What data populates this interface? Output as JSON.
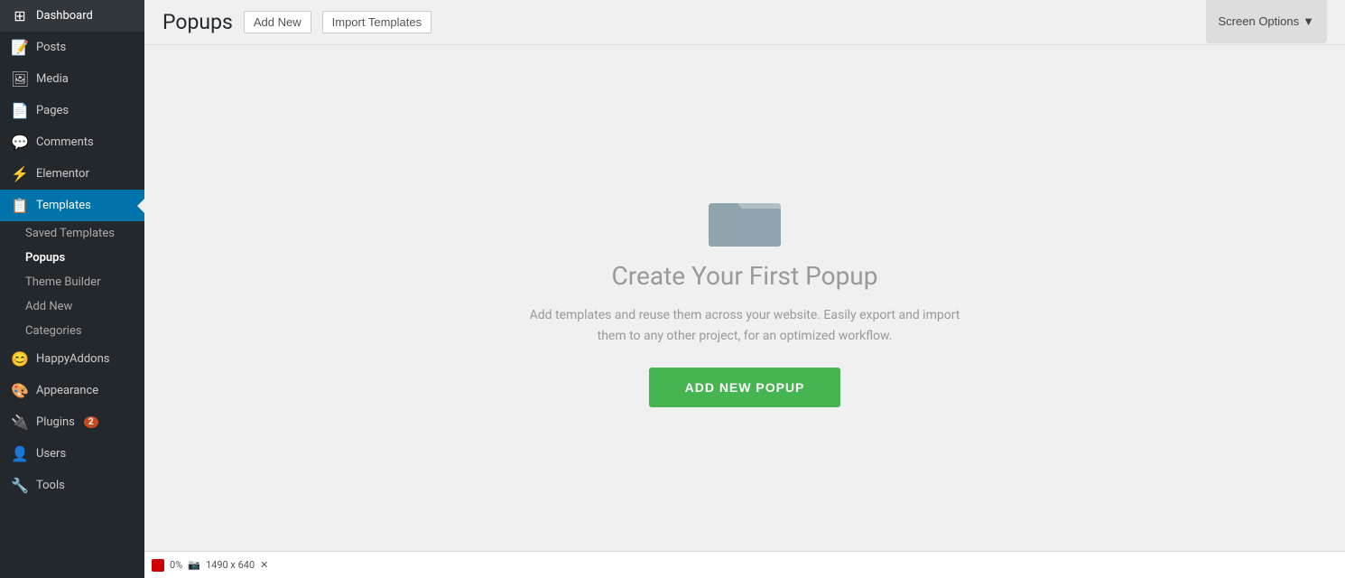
{
  "sidebar": {
    "items": [
      {
        "id": "dashboard",
        "label": "Dashboard",
        "icon": "⊞",
        "active": false
      },
      {
        "id": "posts",
        "label": "Posts",
        "icon": "📝",
        "active": false
      },
      {
        "id": "media",
        "label": "Media",
        "icon": "🖼",
        "active": false
      },
      {
        "id": "pages",
        "label": "Pages",
        "icon": "📄",
        "active": false
      },
      {
        "id": "comments",
        "label": "Comments",
        "icon": "💬",
        "active": false
      },
      {
        "id": "elementor",
        "label": "Elementor",
        "icon": "⚡",
        "active": false
      },
      {
        "id": "templates",
        "label": "Templates",
        "icon": "📋",
        "active": true
      },
      {
        "id": "happyaddons",
        "label": "HappyAddons",
        "icon": "😊",
        "active": false
      },
      {
        "id": "appearance",
        "label": "Appearance",
        "icon": "🎨",
        "active": false
      },
      {
        "id": "plugins",
        "label": "Plugins",
        "icon": "🔌",
        "active": false,
        "badge": "2"
      },
      {
        "id": "users",
        "label": "Users",
        "icon": "👤",
        "active": false
      },
      {
        "id": "tools",
        "label": "Tools",
        "icon": "🔧",
        "active": false
      }
    ],
    "submenu": [
      {
        "id": "saved-templates",
        "label": "Saved Templates",
        "active": false
      },
      {
        "id": "popups",
        "label": "Popups",
        "active": true
      },
      {
        "id": "theme-builder",
        "label": "Theme Builder",
        "active": false
      },
      {
        "id": "add-new",
        "label": "Add New",
        "active": false
      },
      {
        "id": "categories",
        "label": "Categories",
        "active": false
      }
    ]
  },
  "header": {
    "page_title": "Popups",
    "add_new_label": "Add New",
    "import_label": "Import Templates",
    "screen_options_label": "Screen Options"
  },
  "empty_state": {
    "title": "Create Your First Popup",
    "description": "Add templates and reuse them across your website. Easily export and import them to any other project, for an optimized workflow.",
    "button_label": "ADD NEW POPUP"
  },
  "bottom_bar": {
    "percentage": "0%",
    "dimensions": "1490 x 640"
  }
}
